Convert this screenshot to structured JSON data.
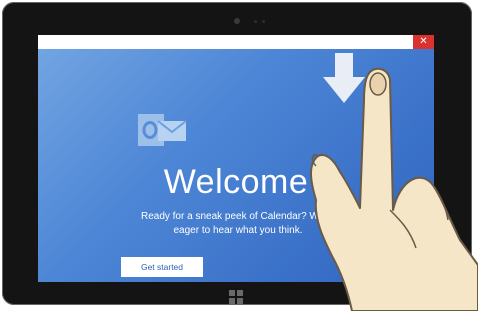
{
  "app": {
    "close_label": "✕",
    "welcome_title": "Welcome",
    "message": "Ready for a sneak peek of Calendar? We're eager to hear what you think.",
    "get_started_label": "Get started"
  },
  "icons": {
    "logo": "outlook-logo-icon",
    "gesture_arrow": "arrow-down-icon",
    "windows_button": "windows-logo-icon",
    "hand": "hand-swipe-down-icon"
  },
  "colors": {
    "screen_blue": "#4d86d6",
    "close_red": "#d9322f",
    "button_text": "#2f63b7"
  }
}
